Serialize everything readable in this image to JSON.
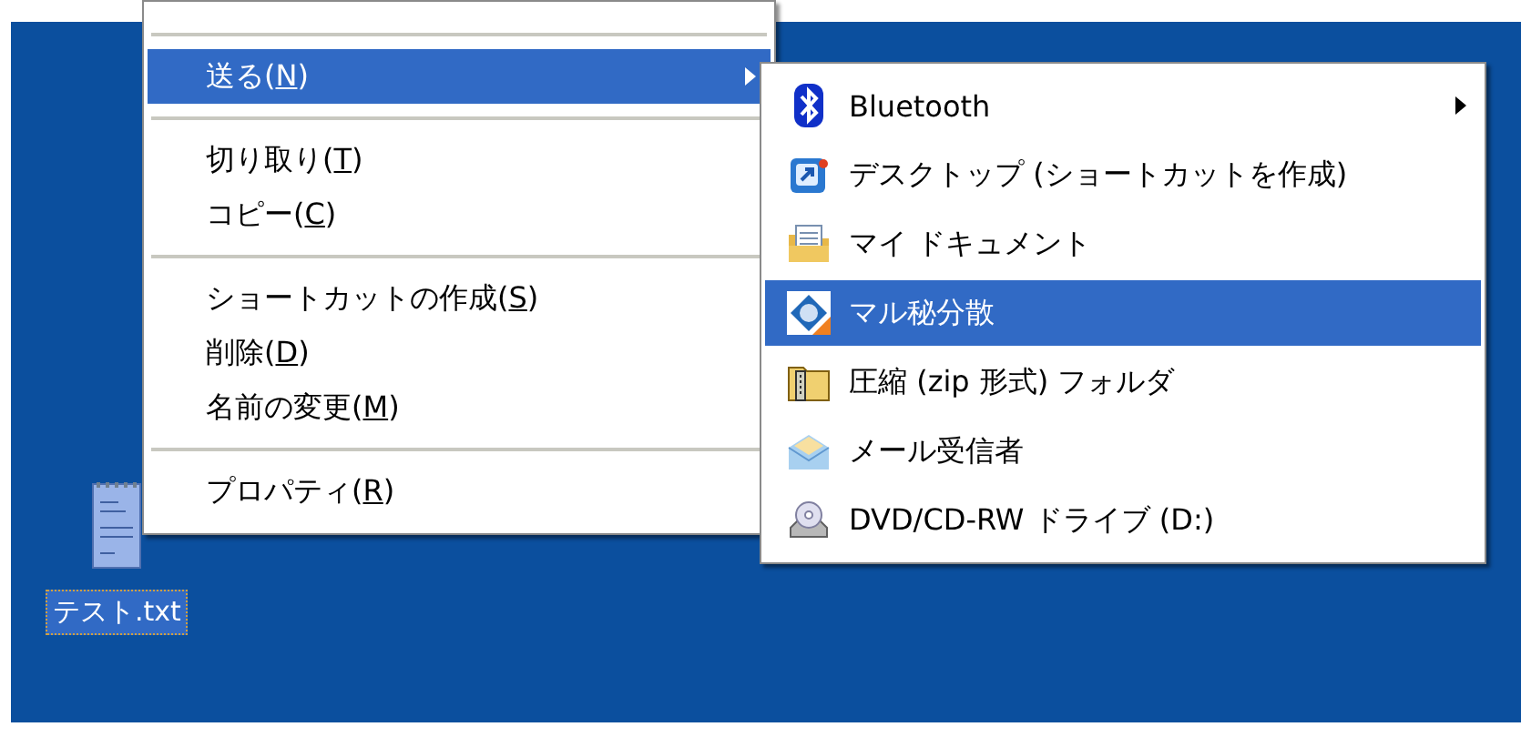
{
  "desktop": {
    "icons": [
      {
        "label": "テスト.txt",
        "selected": true
      }
    ]
  },
  "context_menu": {
    "items": [
      {
        "kind": "separator"
      },
      {
        "kind": "item",
        "text": "送る(",
        "accel": "N",
        "tail": ")",
        "selected": true,
        "submenu": true
      },
      {
        "kind": "separator"
      },
      {
        "kind": "item",
        "text": "切り取り(",
        "accel": "T",
        "tail": ")",
        "selected": false,
        "submenu": false
      },
      {
        "kind": "item",
        "text": "コピー(",
        "accel": "C",
        "tail": ")",
        "selected": false,
        "submenu": false
      },
      {
        "kind": "separator"
      },
      {
        "kind": "item",
        "text": "ショートカットの作成(",
        "accel": "S",
        "tail": ")",
        "selected": false,
        "submenu": false
      },
      {
        "kind": "item",
        "text": "削除(",
        "accel": "D",
        "tail": ")",
        "selected": false,
        "submenu": false
      },
      {
        "kind": "item",
        "text": "名前の変更(",
        "accel": "M",
        "tail": ")",
        "selected": false,
        "submenu": false
      },
      {
        "kind": "separator"
      },
      {
        "kind": "item",
        "text": "プロパティ(",
        "accel": "R",
        "tail": ")",
        "selected": false,
        "submenu": false
      }
    ]
  },
  "send_to_menu": {
    "items": [
      {
        "label": "Bluetooth",
        "selected": false,
        "submenu": true
      },
      {
        "label": "デスクトップ (ショートカットを作成)",
        "selected": false,
        "submenu": false
      },
      {
        "label": "マイ ドキュメント",
        "selected": false,
        "submenu": false
      },
      {
        "label": "マル秘分散",
        "selected": true,
        "submenu": false
      },
      {
        "label": "圧縮 (zip 形式) フォルダ",
        "selected": false,
        "submenu": false
      },
      {
        "label": "メール受信者",
        "selected": false,
        "submenu": false
      },
      {
        "label": "DVD/CD-RW ドライブ (D:)",
        "selected": false,
        "submenu": false
      }
    ]
  }
}
